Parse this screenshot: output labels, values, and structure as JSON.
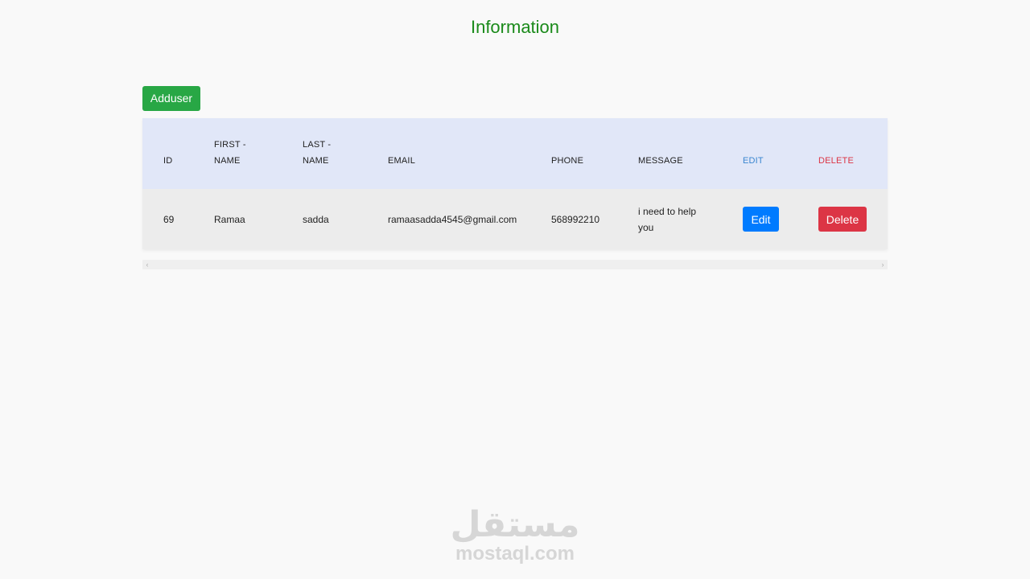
{
  "page": {
    "title": "Information"
  },
  "toolbar": {
    "add_label": "Adduser"
  },
  "table": {
    "headers": {
      "id": "ID",
      "first_line1": "FIRST -",
      "first_line2": "NAME",
      "last_line1": "LAST -",
      "last_line2": "NAME",
      "email": "EMAIL",
      "phone": "PHONE",
      "message": "MESSAGE",
      "edit": "EDIT",
      "delete": "DELETE"
    },
    "rows": [
      {
        "id": "69",
        "first_name": "Ramaa",
        "last_name": "sadda",
        "email": "ramaasadda4545@gmail.com",
        "phone": "568992210",
        "message": "i need to help you",
        "edit_label": "Edit",
        "delete_label": "Delete"
      }
    ]
  },
  "scrollbar": {
    "left_arrow": "‹",
    "right_arrow": "›"
  },
  "watermark": {
    "logo_text": "مستقل",
    "domain": "mostaql.com"
  },
  "colors": {
    "title": "#1a8a1a",
    "add_button": "#28a745",
    "header_bg": "#e1e7f8",
    "row_bg": "#ececec",
    "edit_button": "#007bff",
    "delete_button": "#dc3545"
  }
}
